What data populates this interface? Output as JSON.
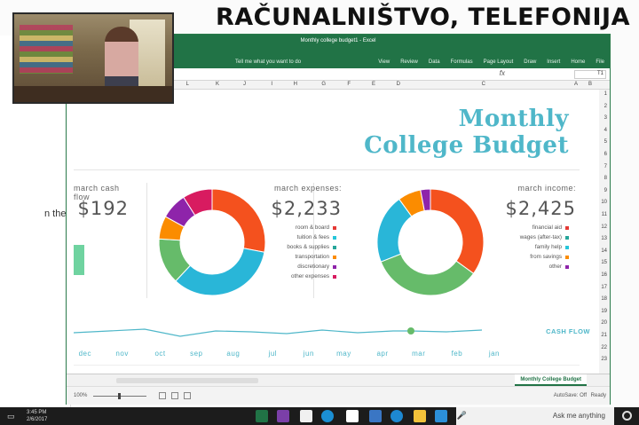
{
  "headline": "RAČUNALNIŠTVO, TELEFONIJA",
  "background_window": {
    "fragment": "n the"
  },
  "excel": {
    "title": "Monthly college budget1 - Excel",
    "tabs": [
      "File",
      "Home",
      "Insert",
      "Draw",
      "Page Layout",
      "Formulas",
      "Data",
      "Review",
      "View"
    ],
    "tellme": "Tell me what you want to do",
    "namebox": "T1",
    "fx": "fx",
    "columns": [
      "B",
      "A",
      "C",
      "D",
      "E",
      "F",
      "G",
      "H",
      "I",
      "J",
      "K",
      "L"
    ],
    "rows": [
      "1",
      "2",
      "3",
      "4",
      "5",
      "6",
      "7",
      "8",
      "9",
      "10",
      "11",
      "12",
      "13",
      "14",
      "15",
      "16",
      "17",
      "18",
      "19",
      "20",
      "21",
      "22",
      "23"
    ],
    "budget_title_line1": "Monthly",
    "budget_title_line2": "College Budget",
    "income": {
      "label": "march income:",
      "value": "$2,425",
      "legend": [
        {
          "label": "financial aid",
          "color": "#e53935"
        },
        {
          "label": "wages (after-tax)",
          "color": "#26a69a"
        },
        {
          "label": "family help",
          "color": "#26c6da"
        },
        {
          "label": "from savings",
          "color": "#fb8c00"
        },
        {
          "label": "other",
          "color": "#8e24aa"
        }
      ]
    },
    "expenses": {
      "label": "march expenses:",
      "value": "$2,233",
      "legend": [
        {
          "label": "room & board",
          "color": "#e53935"
        },
        {
          "label": "tuition & fees",
          "color": "#26c6da"
        },
        {
          "label": "books & supplies",
          "color": "#26a69a"
        },
        {
          "label": "transportation",
          "color": "#fb8c00"
        },
        {
          "label": "discretionary",
          "color": "#8e24aa"
        },
        {
          "label": "other expenses",
          "color": "#d81b60"
        }
      ]
    },
    "cash": {
      "label": "march cash flow",
      "value": "$192"
    },
    "cashflow_label": "CASH FLOW",
    "months": [
      "jan",
      "feb",
      "mar",
      "apr",
      "may",
      "jun",
      "jul",
      "aug",
      "sep",
      "oct",
      "nov",
      "dec"
    ],
    "sheet_tab": "Monthly College Budget",
    "status": {
      "ready": "Ready",
      "autosave": "AutoSave: Off",
      "zoom": "100%"
    }
  },
  "taskbar": {
    "search_text": "Ask me anything",
    "clock_time": "3:45 PM",
    "clock_date": "2/6/2017"
  },
  "chart_data": [
    {
      "type": "pie",
      "categories": [
        "financial aid",
        "wages (after-tax)",
        "family help",
        "from savings",
        "other"
      ],
      "values": [
        35,
        34,
        21,
        7,
        3
      ],
      "colors": [
        "#f4511e",
        "#66bb6a",
        "#29b6d8",
        "#fb8c00",
        "#8e24aa"
      ]
    },
    {
      "type": "pie",
      "categories": [
        "room & board",
        "tuition & fees",
        "books & supplies",
        "transportation",
        "discretionary",
        "other expenses"
      ],
      "values": [
        28,
        34,
        14,
        7,
        8,
        9
      ],
      "colors": [
        "#f4511e",
        "#29b6d8",
        "#66bb6a",
        "#fb8c00",
        "#8e24aa",
        "#d81b60"
      ]
    }
  ]
}
